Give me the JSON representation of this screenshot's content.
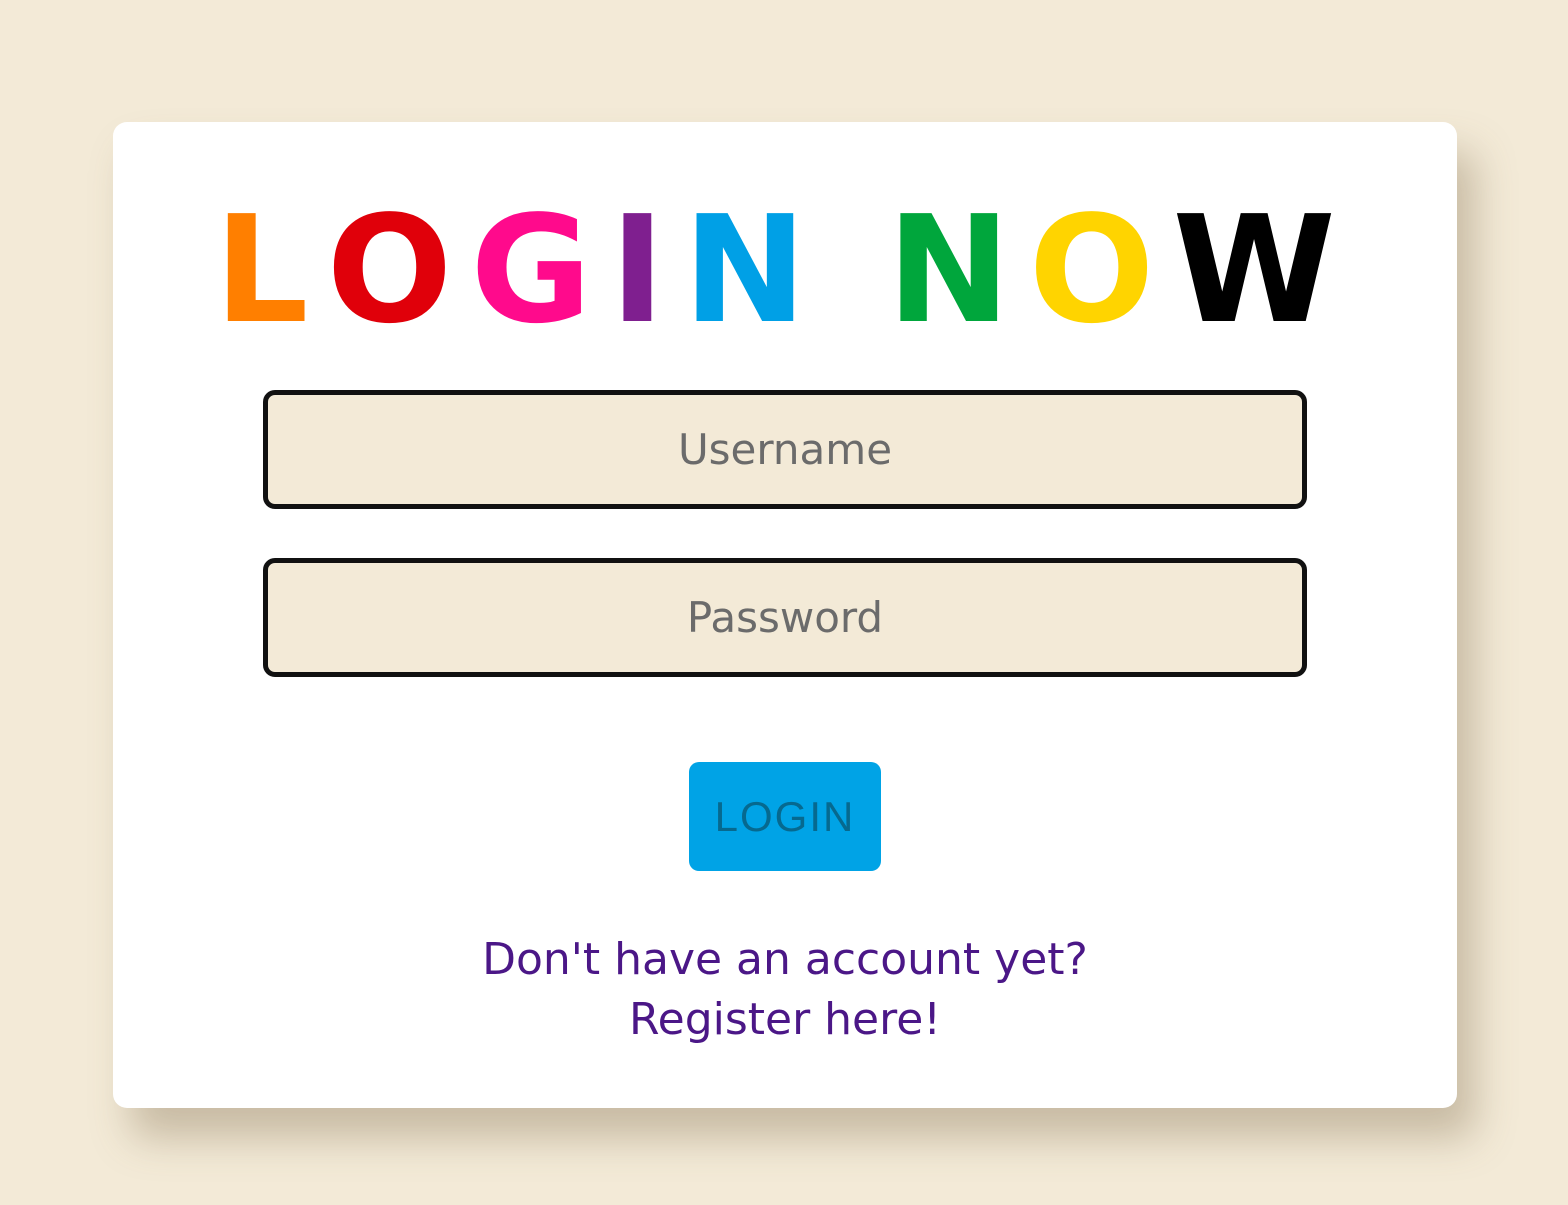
{
  "page": {
    "background_color": "#f3ead7",
    "card_color": "#ffffff"
  },
  "title": {
    "letters": [
      {
        "char": "L",
        "color": "#ff7f00"
      },
      {
        "char": "O",
        "color": "#e0000a"
      },
      {
        "char": "G",
        "color": "#ff0a8c"
      },
      {
        "char": "I",
        "color": "#7f1f8f"
      },
      {
        "char": "N",
        "color": "#00a0e6"
      },
      {
        "char": " ",
        "color": ""
      },
      {
        "char": "N",
        "color": "#00a63c"
      },
      {
        "char": "O",
        "color": "#ffd400"
      },
      {
        "char": "W",
        "color": "#000000"
      }
    ]
  },
  "form": {
    "username_placeholder": "Username",
    "password_placeholder": "Password",
    "login_label": "LOGIN",
    "login_color": "#00a3e6"
  },
  "register": {
    "question": "Don't have an account yet?",
    "link_label": "Register here!",
    "color": "#4b1787"
  }
}
